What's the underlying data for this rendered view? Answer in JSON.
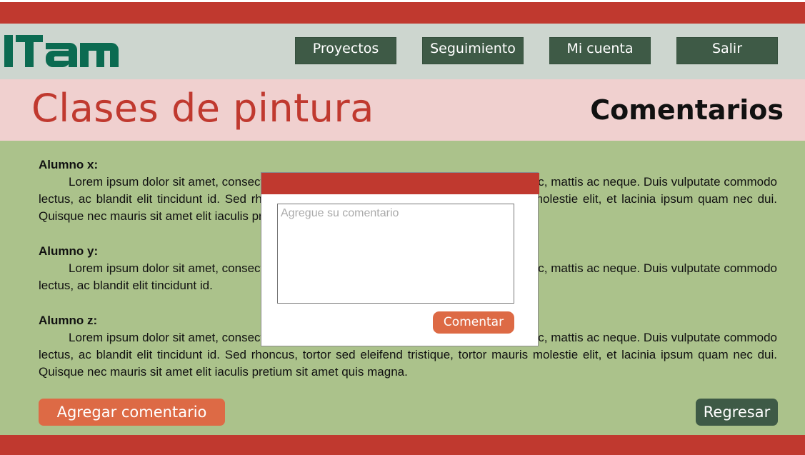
{
  "app": {
    "logo_text": "ITAM",
    "brand_color": "#0b6b51"
  },
  "nav": {
    "items": [
      {
        "label": "Proyectos"
      },
      {
        "label": "Seguimiento"
      },
      {
        "label": "Mi cuenta"
      },
      {
        "label": "Salir"
      }
    ]
  },
  "page": {
    "title": "Clases de pintura",
    "section": "Comentarios"
  },
  "comments": [
    {
      "author": "Alumno x:",
      "text": "Lorem ipsum dolor sit amet, consectetur adipiscing elit. Donec vulputate eu pharetra nec, mattis ac neque. Duis vulputate commodo lectus, ac blandit elit tincidunt id. Sed rhoncus, tortor sed eleifend tristique, tortor mauris molestie elit, et lacinia ipsum quam nec dui. Quisque nec mauris sit amet elit iaculis pretium sit amet quis magna."
    },
    {
      "author": "Alumno y:",
      "text": "Lorem ipsum dolor sit amet, consectetur adipiscing elit. Donec vulputate eu pharetra nec, mattis ac neque. Duis vulputate commodo lectus, ac blandit elit tincidunt id."
    },
    {
      "author": "Alumno z:",
      "text": "Lorem ipsum dolor sit amet, consectetur adipiscing elit. Donec vulputate eu pharetra nec, mattis ac neque. Duis vulputate commodo lectus, ac blandit elit tincidunt id. Sed rhoncus, tortor sed eleifend tristique, tortor mauris molestie elit, et lacinia ipsum quam nec dui. Quisque nec mauris sit amet elit iaculis pretium sit amet quis magna."
    }
  ],
  "actions": {
    "add_comment": "Agregar comentario",
    "back": "Regresar"
  },
  "modal": {
    "placeholder": "Agregue su comentario",
    "submit": "Comentar"
  },
  "colors": {
    "bar_red": "#c0392f",
    "header_gray": "#cdd6cf",
    "title_band_pink": "#f0d0cf",
    "content_green": "#abc28b",
    "nav_dark_green": "#3e5a46",
    "accent_orange": "#dd6a45"
  }
}
